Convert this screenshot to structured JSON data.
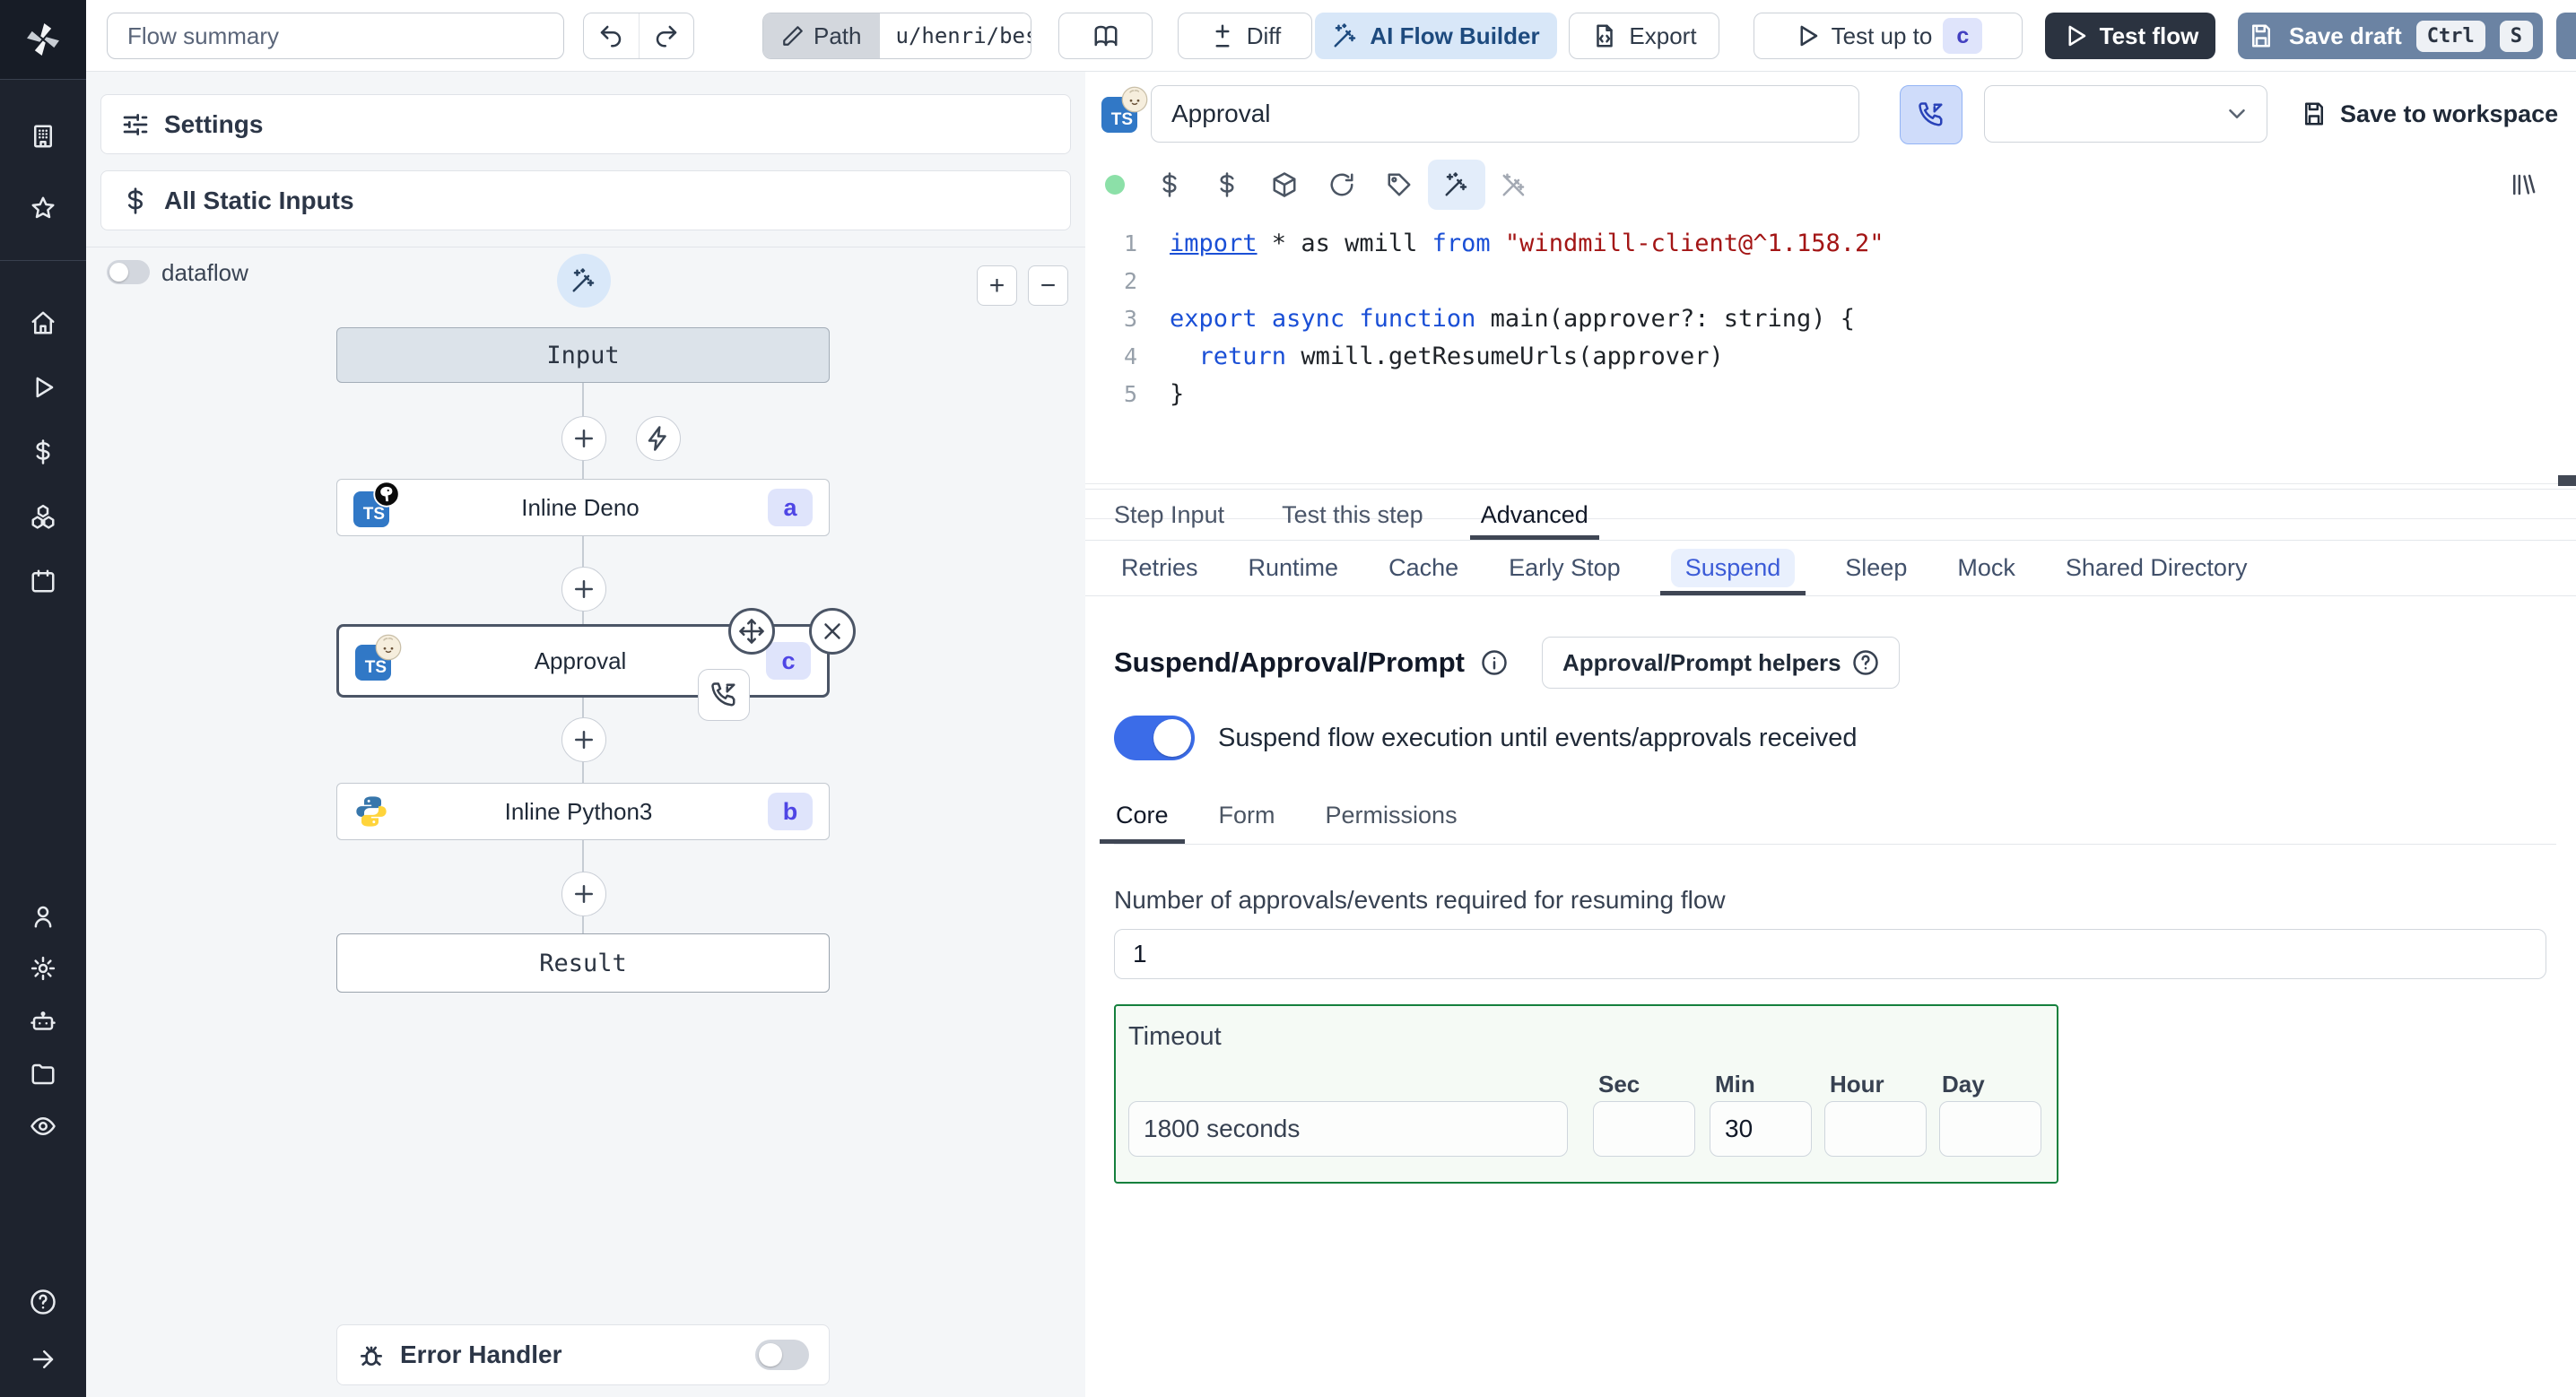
{
  "topbar": {
    "flow_summary_value": "Flow summary",
    "path_label": "Path",
    "path_value": "u/henri/bes",
    "diff_label": "Diff",
    "ai_flow_builder_label": "AI Flow Builder",
    "export_label": "Export",
    "test_up_to_label": "Test up to",
    "test_up_to_badge": "c",
    "test_flow_label": "Test flow",
    "save_draft_label": "Save draft",
    "kbd_ctrl": "Ctrl",
    "kbd_s": "S"
  },
  "sidebar": {
    "top_icons": [
      "windmill-logo",
      "building",
      "star"
    ],
    "middle_icons": [
      "home",
      "play",
      "dollar",
      "boxes",
      "calendar"
    ],
    "bottom_icons": [
      "user",
      "gear",
      "robot",
      "folder",
      "eye",
      "help-circle",
      "arrow-right"
    ]
  },
  "flow_panel": {
    "settings_label": "Settings",
    "all_static_inputs_label": "All Static Inputs",
    "dataflow_label": "dataflow",
    "zoom_in_label": "+",
    "zoom_out_label": "−",
    "nodes": {
      "input_label": "Input",
      "deno_label": "Inline Deno",
      "deno_badge": "a",
      "deno_lang": "TS",
      "approval_label": "Approval",
      "approval_badge": "c",
      "approval_lang": "TS",
      "python_label": "Inline Python3",
      "python_badge": "b",
      "result_label": "Result"
    },
    "error_handler_label": "Error Handler"
  },
  "step_panel": {
    "name_value": "Approval",
    "save_to_workspace_label": "Save to workspace",
    "code": {
      "lines": [
        {
          "n": "1",
          "seg": [
            [
              "kw lnk",
              "import"
            ],
            [
              "txt",
              " * as wmill "
            ],
            [
              "kw",
              "from"
            ],
            [
              "txt",
              " "
            ],
            [
              "str",
              "\"windmill-client@^1.158.2\""
            ]
          ]
        },
        {
          "n": "2",
          "seg": []
        },
        {
          "n": "3",
          "seg": [
            [
              "kw",
              "export"
            ],
            [
              "txt",
              " "
            ],
            [
              "kw",
              "async"
            ],
            [
              "txt",
              " "
            ],
            [
              "kw",
              "function"
            ],
            [
              "txt",
              " main(approver?: string) {"
            ]
          ]
        },
        {
          "n": "4",
          "seg": [
            [
              "txt",
              "  "
            ],
            [
              "kw",
              "return"
            ],
            [
              "txt",
              " wmill.getResumeUrls(approver)"
            ]
          ]
        },
        {
          "n": "5",
          "seg": [
            [
              "txt",
              "}"
            ]
          ]
        }
      ]
    },
    "tabs": [
      {
        "label": "Step Input",
        "active": false
      },
      {
        "label": "Test this step",
        "active": false
      },
      {
        "label": "Advanced",
        "active": true
      }
    ],
    "subtabs": [
      "Retries",
      "Runtime",
      "Cache",
      "Early Stop",
      "Suspend",
      "Sleep",
      "Mock",
      "Shared Directory"
    ],
    "active_subtab": "Suspend",
    "suspend": {
      "title": "Suspend/Approval/Prompt",
      "helpers_label": "Approval/Prompt helpers",
      "toggle_label": "Suspend flow execution until events/approvals received",
      "inner_tabs": [
        "Core",
        "Form",
        "Permissions"
      ],
      "active_inner_tab": "Core",
      "approvals_label": "Number of approvals/events required for resuming flow",
      "approvals_value": "1",
      "timeout_label": "Timeout",
      "timeout_value": "1800 seconds",
      "unit_sec": "Sec",
      "unit_min": "Min",
      "unit_hour": "Hour",
      "unit_day": "Day",
      "sec_value": "",
      "min_value": "30",
      "hour_value": "",
      "day_value": ""
    }
  },
  "colors": {
    "rail_bg": "#1e232e",
    "accent_light_blue": "#d8e7f8",
    "dark_button": "#2b3340",
    "save_draft": "#6b83a3",
    "badge_bg": "#dfe4fb",
    "badge_text": "#4f46e5",
    "toggle_on": "#3b6ce8",
    "timeout_border": "#15803d",
    "keyword": "#1a4fd6",
    "string": "#a31515",
    "ts_badge": "#3178c6"
  }
}
